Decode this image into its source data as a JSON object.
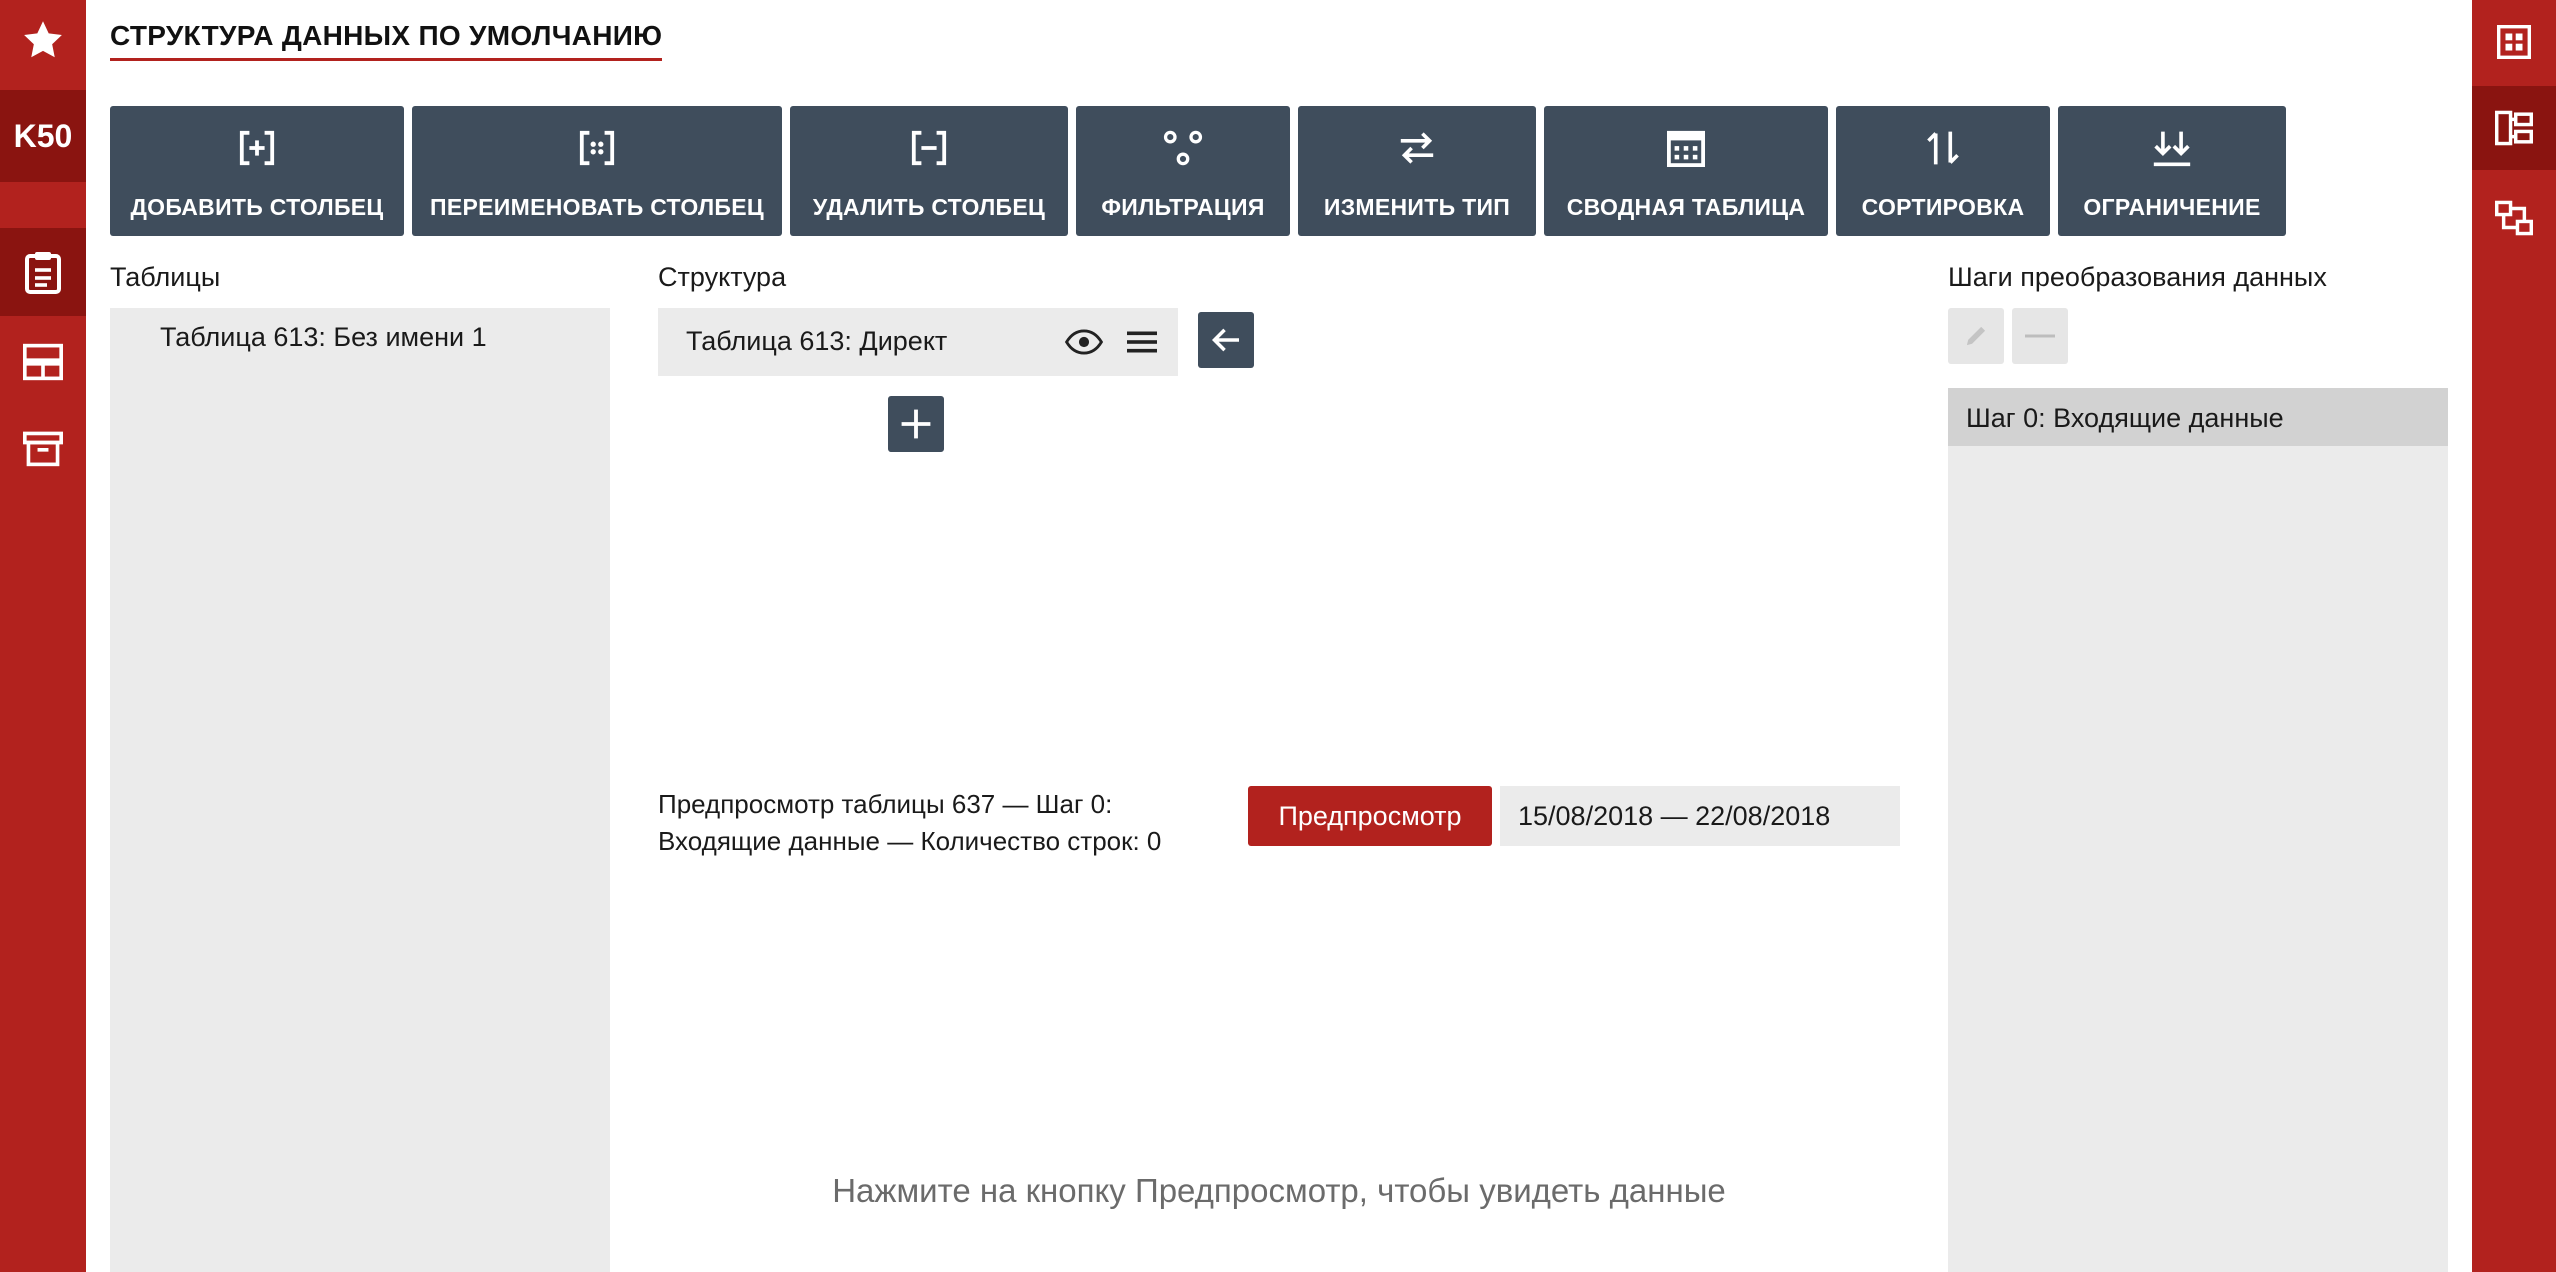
{
  "app": {
    "brand": "K50",
    "page_title": "СТРУКТУРА ДАННЫХ ПО УМОЛЧАНИЮ"
  },
  "left_nav": [
    {
      "icon": "star-icon"
    },
    {
      "icon": "clipboard-icon",
      "active": true
    },
    {
      "icon": "layout-rows-icon"
    },
    {
      "icon": "archive-icon"
    }
  ],
  "right_nav": [
    {
      "icon": "grid-icon"
    },
    {
      "icon": "structure-icon",
      "active": true
    },
    {
      "icon": "flow-icon"
    }
  ],
  "toolbar": {
    "add_column": "ДОБАВИТЬ СТОЛБЕЦ",
    "rename_column": "ПЕРЕИМЕНОВАТЬ СТОЛБЕЦ",
    "delete_column": "УДАЛИТЬ СТОЛБЕЦ",
    "filter": "ФИЛЬТРАЦИЯ",
    "change_type": "ИЗМЕНИТЬ ТИП",
    "pivot": "СВОДНАЯ ТАБЛИЦА",
    "sort": "СОРТИРОВКА",
    "limit": "ОГРАНИЧЕНИЕ"
  },
  "tables": {
    "heading": "Таблицы",
    "items": [
      "Таблица 613: Без имени 1"
    ]
  },
  "structure": {
    "heading": "Структура",
    "card_name": "Таблица 613: Директ"
  },
  "preview": {
    "line1": "Предпросмотр таблицы 637 — Шаг 0:",
    "line2": "Входящие данные — Количество строк: 0",
    "button": "Предпросмотр",
    "date_range": "15/08/2018 — 22/08/2018",
    "hint": "Нажмите на кнопку Предпросмотр, чтобы увидеть данные"
  },
  "steps": {
    "heading": "Шаги преобразования данных",
    "items": [
      "Шаг 0: Входящие данные"
    ]
  },
  "colors": {
    "brand_red": "#b2221e",
    "brand_dark_red": "#8a1410",
    "toolbar_slate": "#3f4d5c",
    "panel_gray": "#ebebeb"
  }
}
